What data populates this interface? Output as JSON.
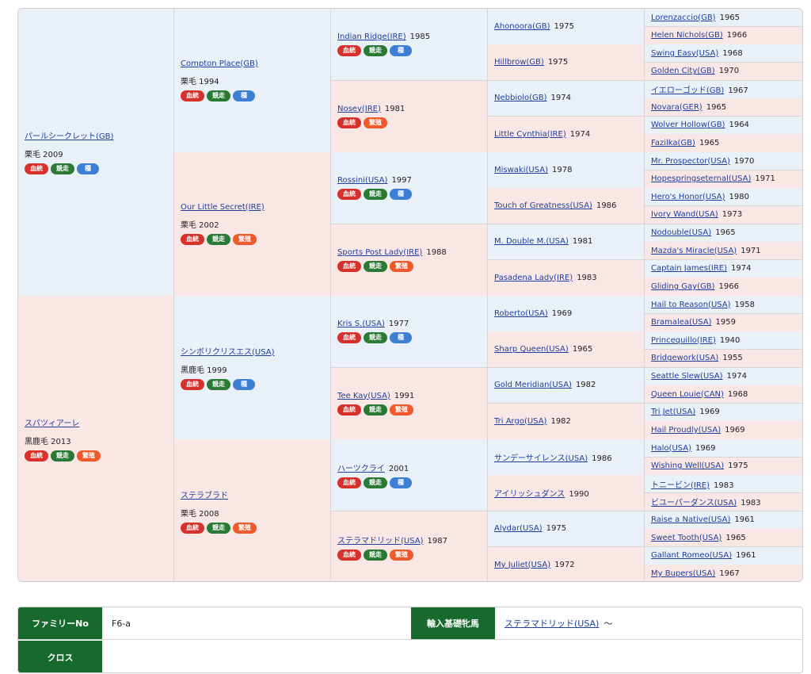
{
  "badge_colors": {
    "red": "#d8312b",
    "green": "#2a7a36",
    "blue": "#3c7fd4",
    "orange": "#ee5a2b"
  },
  "row_colors": {
    "sire": "#e9f0f7",
    "dam": "#f9e7e6",
    "header": "#17692d"
  },
  "pedigree": {
    "g1": [
      {
        "name": "パールシークレット(GB)",
        "coat": "栗毛 2009",
        "badges": [
          {
            "label": "血統",
            "color": "red"
          },
          {
            "label": "競走",
            "color": "green"
          },
          {
            "label": "種",
            "color": "blue"
          }
        ]
      },
      {
        "name": "スパツィアーレ",
        "coat": "黒鹿毛 2013",
        "badges": [
          {
            "label": "血統",
            "color": "red"
          },
          {
            "label": "競走",
            "color": "green"
          },
          {
            "label": "繁殖",
            "color": "orange"
          }
        ]
      }
    ],
    "g2": [
      {
        "name": "Compton Place(GB)",
        "coat": "栗毛 1994",
        "badges": [
          {
            "label": "血統",
            "color": "red"
          },
          {
            "label": "競走",
            "color": "green"
          },
          {
            "label": "種",
            "color": "blue"
          }
        ]
      },
      {
        "name": "Our Little Secret(IRE)",
        "coat": "栗毛 2002",
        "badges": [
          {
            "label": "血統",
            "color": "red"
          },
          {
            "label": "競走",
            "color": "green"
          },
          {
            "label": "繁殖",
            "color": "orange"
          }
        ]
      },
      {
        "name": "シンボリクリスエス(USA)",
        "coat": "黒鹿毛 1999",
        "badges": [
          {
            "label": "血統",
            "color": "red"
          },
          {
            "label": "競走",
            "color": "green"
          },
          {
            "label": "種",
            "color": "blue"
          }
        ]
      },
      {
        "name": "ステラブラド",
        "coat": "栗毛 2008",
        "badges": [
          {
            "label": "血統",
            "color": "red"
          },
          {
            "label": "競走",
            "color": "green"
          },
          {
            "label": "繁殖",
            "color": "orange"
          }
        ]
      }
    ],
    "g3": [
      {
        "name": "Indian Ridge(IRE)",
        "year": "1985",
        "badges": [
          {
            "label": "血統",
            "color": "red"
          },
          {
            "label": "競走",
            "color": "green"
          },
          {
            "label": "種",
            "color": "blue"
          }
        ]
      },
      {
        "name": "Nosey(IRE)",
        "year": "1981",
        "badges": [
          {
            "label": "血統",
            "color": "red"
          },
          {
            "label": "繁殖",
            "color": "orange"
          }
        ]
      },
      {
        "name": "Rossini(USA)",
        "year": "1997",
        "badges": [
          {
            "label": "血統",
            "color": "red"
          },
          {
            "label": "競走",
            "color": "green"
          },
          {
            "label": "種",
            "color": "blue"
          }
        ]
      },
      {
        "name": "Sports Post Lady(IRE)",
        "year": "1988",
        "badges": [
          {
            "label": "血統",
            "color": "red"
          },
          {
            "label": "競走",
            "color": "green"
          },
          {
            "label": "繁殖",
            "color": "orange"
          }
        ]
      },
      {
        "name": "Kris S.(USA)",
        "year": "1977",
        "badges": [
          {
            "label": "血統",
            "color": "red"
          },
          {
            "label": "競走",
            "color": "green"
          },
          {
            "label": "種",
            "color": "blue"
          }
        ]
      },
      {
        "name": "Tee Kay(USA)",
        "year": "1991",
        "badges": [
          {
            "label": "血統",
            "color": "red"
          },
          {
            "label": "競走",
            "color": "green"
          },
          {
            "label": "繁殖",
            "color": "orange"
          }
        ]
      },
      {
        "name": "ハーツクライ",
        "year": "2001",
        "badges": [
          {
            "label": "血統",
            "color": "red"
          },
          {
            "label": "競走",
            "color": "green"
          },
          {
            "label": "種",
            "color": "blue"
          }
        ]
      },
      {
        "name": "ステラマドリッド(USA)",
        "year": "1987",
        "badges": [
          {
            "label": "血統",
            "color": "red"
          },
          {
            "label": "競走",
            "color": "green"
          },
          {
            "label": "繁殖",
            "color": "orange"
          }
        ]
      }
    ],
    "g4": [
      {
        "name": "Ahonoora(GB)",
        "year": "1975"
      },
      {
        "name": "Hillbrow(GB)",
        "year": "1975"
      },
      {
        "name": "Nebbiolo(GB)",
        "year": "1974"
      },
      {
        "name": "Little Cynthia(IRE)",
        "year": "1974"
      },
      {
        "name": "Miswaki(USA)",
        "year": "1978"
      },
      {
        "name": "Touch of Greatness(USA)",
        "year": "1986"
      },
      {
        "name": "M. Double M.(USA)",
        "year": "1981"
      },
      {
        "name": "Pasadena Lady(IRE)",
        "year": "1983"
      },
      {
        "name": "Roberto(USA)",
        "year": "1969"
      },
      {
        "name": "Sharp Queen(USA)",
        "year": "1965"
      },
      {
        "name": "Gold Meridian(USA)",
        "year": "1982"
      },
      {
        "name": "Tri Argo(USA)",
        "year": "1982"
      },
      {
        "name": "サンデーサイレンス(USA)",
        "year": "1986"
      },
      {
        "name": "アイリッシュダンス",
        "year": "1990"
      },
      {
        "name": "Alydar(USA)",
        "year": "1975"
      },
      {
        "name": "My Juliet(USA)",
        "year": "1972"
      }
    ],
    "g5": [
      {
        "name": "Lorenzaccio(GB)",
        "year": "1965"
      },
      {
        "name": "Helen Nichols(GB)",
        "year": "1966"
      },
      {
        "name": "Swing Easy(USA)",
        "year": "1968"
      },
      {
        "name": "Golden City(GB)",
        "year": "1970"
      },
      {
        "name": "イエローゴッド(GB)",
        "year": "1967"
      },
      {
        "name": "Novara(GER)",
        "year": "1965"
      },
      {
        "name": "Wolver Hollow(GB)",
        "year": "1964"
      },
      {
        "name": "Fazilka(GB)",
        "year": "1965"
      },
      {
        "name": "Mr. Prospector(USA)",
        "year": "1970"
      },
      {
        "name": "Hopespringseternal(USA)",
        "year": "1971"
      },
      {
        "name": "Hero's Honor(USA)",
        "year": "1980"
      },
      {
        "name": "Ivory Wand(USA)",
        "year": "1973"
      },
      {
        "name": "Nodouble(USA)",
        "year": "1965"
      },
      {
        "name": "Mazda's Miracle(USA)",
        "year": "1971"
      },
      {
        "name": "Captain James(IRE)",
        "year": "1974"
      },
      {
        "name": "Gliding Gay(GB)",
        "year": "1966"
      },
      {
        "name": "Hail to Reason(USA)",
        "year": "1958"
      },
      {
        "name": "Bramalea(USA)",
        "year": "1959"
      },
      {
        "name": "Princequillo(IRE)",
        "year": "1940"
      },
      {
        "name": "Bridgework(USA)",
        "year": "1955"
      },
      {
        "name": "Seattle Slew(USA)",
        "year": "1974"
      },
      {
        "name": "Queen Louie(CAN)",
        "year": "1968"
      },
      {
        "name": "Tri Jet(USA)",
        "year": "1969"
      },
      {
        "name": "Hail Proudly(USA)",
        "year": "1969"
      },
      {
        "name": "Halo(USA)",
        "year": "1969"
      },
      {
        "name": "Wishing Well(USA)",
        "year": "1975"
      },
      {
        "name": "トニービン(IRE)",
        "year": "1983"
      },
      {
        "name": "ビユーパーダンス(USA)",
        "year": "1983"
      },
      {
        "name": "Raise a Native(USA)",
        "year": "1961"
      },
      {
        "name": "Sweet Tooth(USA)",
        "year": "1965"
      },
      {
        "name": "Gallant Romeo(USA)",
        "year": "1961"
      },
      {
        "name": "My Bupers(USA)",
        "year": "1967"
      }
    ]
  },
  "info": {
    "family_label": "ファミリーNo",
    "family_value": "F6-a",
    "import_label": "輸入基礎牝馬",
    "import_value": "ステラマドリッド(USA)",
    "import_suffix": "〜",
    "cross_label": "クロス",
    "cross_value": ""
  }
}
